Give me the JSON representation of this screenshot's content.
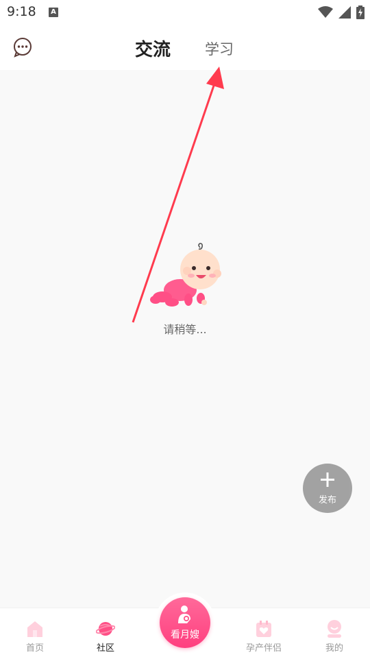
{
  "status": {
    "time": "9:18",
    "a_badge": "A"
  },
  "header": {
    "tab_main": "交流",
    "tab_second": "学习"
  },
  "content": {
    "loading_text": "请稍等..."
  },
  "publish": {
    "label": "发布"
  },
  "tabbar": {
    "items": [
      {
        "label": "首页",
        "icon": "home-icon"
      },
      {
        "label": "社区",
        "icon": "planet-icon"
      },
      {
        "label": "看月嫂",
        "icon": "nanny-icon"
      },
      {
        "label": "孕产伴侣",
        "icon": "calendar-heart-icon"
      },
      {
        "label": "我的",
        "icon": "profile-icon"
      }
    ],
    "active_index": 1
  },
  "colors": {
    "accent": "#ff4d88",
    "accent_light": "#ffc7d9",
    "arrow": "#ff3b4e"
  }
}
